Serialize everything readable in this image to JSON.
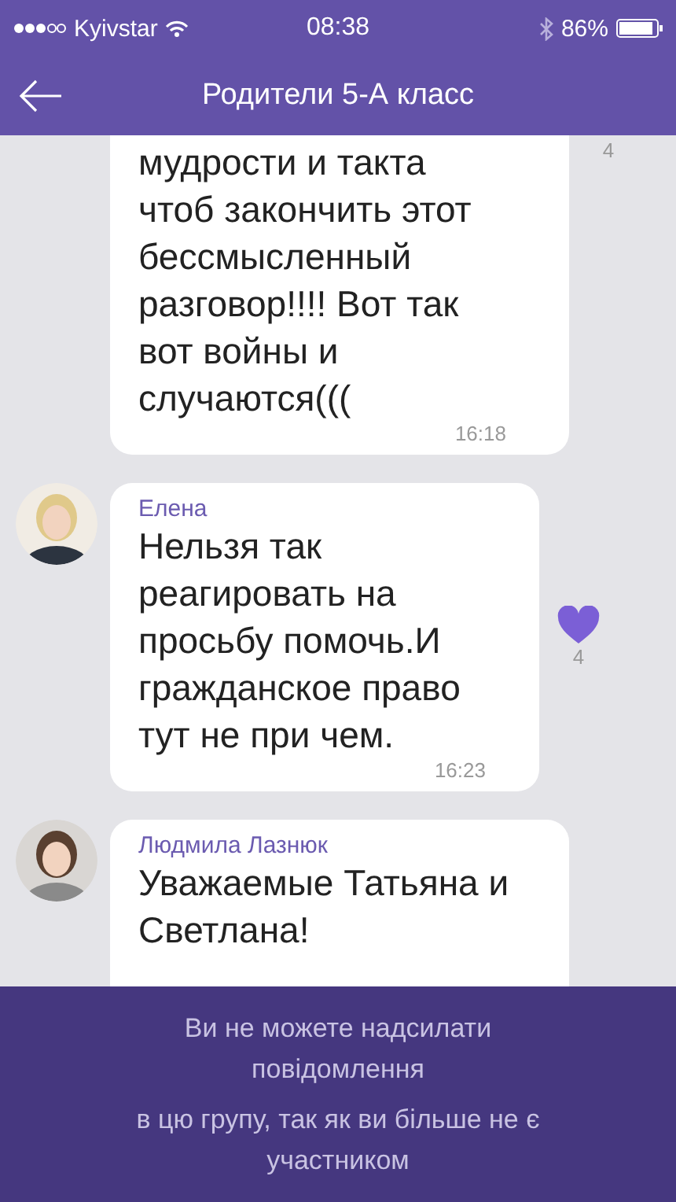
{
  "status_bar": {
    "carrier": "Kyivstar",
    "time": "08:38",
    "battery": "86%"
  },
  "header": {
    "title": "Родители 5-А класс"
  },
  "messages": [
    {
      "kind": "continued",
      "text": "мудрости и такта чтоб закончить этот бессмысленный разговор!!!! Вот так вот войны и случаются(((",
      "time": "16:18",
      "reaction": {
        "kind": "count",
        "count": "4"
      }
    },
    {
      "kind": "full",
      "sender": "Елена",
      "text": "Нельзя так реагировать на просьбу помочь.И гражданское право тут не при чем.",
      "time": "16:23",
      "reaction": {
        "kind": "heart",
        "count": "4"
      }
    },
    {
      "kind": "full",
      "sender": "Людмила Лазнюк",
      "text": "Уважаемые Татьяна и Светлана!"
    }
  ],
  "notice": {
    "lines": [
      "Ви не можете надсилати повідомлення",
      "в цю групу, так як ви більше не є участником"
    ]
  }
}
